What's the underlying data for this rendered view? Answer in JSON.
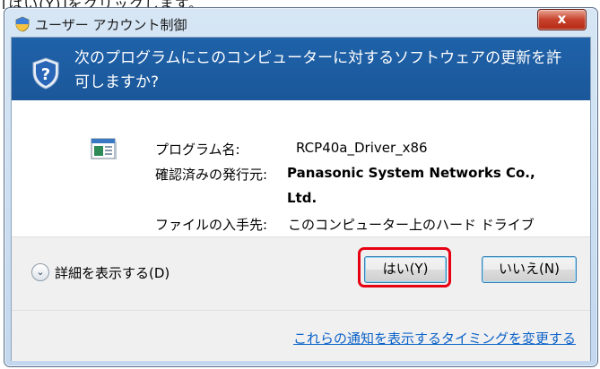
{
  "top_strip": {
    "text_before": "[はい(",
    "underlined": "Y",
    "text_after": ")]をクリックします。"
  },
  "window": {
    "title": "ユーザー アカウント制御",
    "close_label": "x"
  },
  "header": {
    "message": "次のプログラムにこのコンピューターに対するソフトウェアの更新を許可しますか?"
  },
  "details": {
    "program_label": "プログラム名:",
    "program_value": "RCP40a_Driver_x86",
    "publisher_label": "確認済みの発行元:",
    "publisher_value_line1": "Panasonic System Networks Co.,",
    "publisher_value_line2": "Ltd.",
    "origin_label": "ファイルの入手先:",
    "origin_value": "このコンピューター上のハード ドライブ"
  },
  "footer": {
    "show_details": "詳細を表示する(D)",
    "yes_button": "はい(Y)",
    "no_button": "いいえ(N)",
    "notification_link": "これらの通知を表示するタイミングを変更する"
  },
  "colors": {
    "header_bg": "#1f62a9",
    "highlight": "#e60012",
    "link": "#0b62c8",
    "close_button": "#c7412c"
  }
}
